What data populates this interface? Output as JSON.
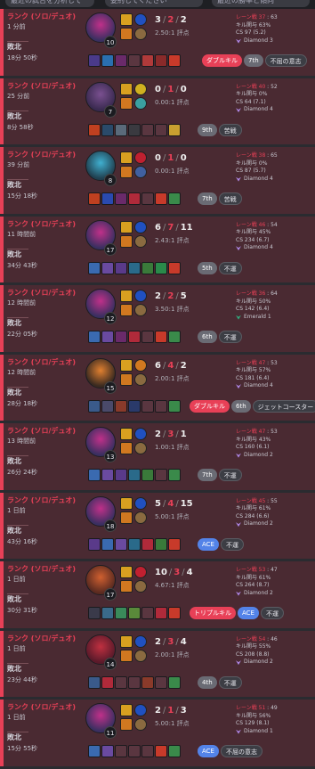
{
  "topbar": {
    "pills": [
      "最近の試合を分析して",
      "要約してください",
      "最近の勝率と傾向"
    ]
  },
  "matches": [
    {
      "queue": "ランク (ソロ/デュオ)",
      "ago": "1 分前",
      "result": "敗北",
      "duration": "18分 50秒",
      "level": "10",
      "kills": "3",
      "deaths": "2",
      "assists": "2",
      "ratio": "2.50:1 評点",
      "lane_label": "レーン戦",
      "lane_value": "37",
      "lane_extra": "63",
      "kp": "キル関与 63%",
      "cs": "CS 97 (5.2)",
      "rank": "Diamond 3",
      "rank_color": "#b088e8",
      "tags": [
        "ダブルキル",
        "7th",
        "不屈の意志"
      ],
      "tag_styles": [
        "red",
        "grey",
        "dark"
      ],
      "champ_colors": [
        "#3a2f60",
        "#c0308a"
      ],
      "item_colors": [
        "#4a3a8a",
        "#2a6fb0",
        "#6a2a6a",
        "#5a3640",
        "#b03a3a",
        "#8a2a2a",
        "#c83a2a"
      ],
      "spell_colors": [
        "#d8a020",
        "#2050c0",
        "#d07820",
        "#8a6a40"
      ]
    },
    {
      "queue": "ランク (ソロ/デュオ)",
      "ago": "25 分前",
      "result": "敗北",
      "duration": "8分 58秒",
      "level": "7",
      "kills": "0",
      "deaths": "1",
      "assists": "0",
      "ratio": "0.00:1 評点",
      "lane_label": "レーン戦",
      "lane_value": "40",
      "lane_extra": "52",
      "kp": "キル関与 0%",
      "cs": "CS 64 (7.1)",
      "rank": "Diamond 4",
      "rank_color": "#b088e8",
      "tags": [
        "9th",
        "苦戦"
      ],
      "tag_styles": [
        "grey",
        "dark"
      ],
      "champ_colors": [
        "#3a2a50",
        "#7a5090"
      ],
      "item_colors": [
        "#c04020",
        "#2a4a6a",
        "#5a6a7a",
        "#3a3a40",
        "#5a3640",
        "#5a3640",
        "#c8a030"
      ],
      "spell_colors": [
        "#d8a020",
        "#d0b020",
        "#d07820",
        "#3aa0a0"
      ]
    },
    {
      "queue": "ランク (ソロ/デュオ)",
      "ago": "39 分前",
      "result": "敗北",
      "duration": "15分 18秒",
      "level": "8",
      "kills": "0",
      "deaths": "1",
      "assists": "0",
      "ratio": "0.00:1 評点",
      "lane_label": "レーン戦",
      "lane_value": "38",
      "lane_extra": "65",
      "kp": "キル関与 0%",
      "cs": "CS 87 (5.7)",
      "rank": "Diamond 4",
      "rank_color": "#b088e8",
      "tags": [
        "7th",
        "苦戦"
      ],
      "tag_styles": [
        "grey",
        "dark"
      ],
      "champ_colors": [
        "#204050",
        "#40b0d0"
      ],
      "item_colors": [
        "#c04020",
        "#2a4ab0",
        "#6a2a6a",
        "#b02a3a",
        "#5a3640",
        "#c83a2a",
        "#3a8a4a"
      ],
      "spell_colors": [
        "#d8a020",
        "#c02030",
        "#d07820",
        "#4060a0"
      ]
    },
    {
      "queue": "ランク (ソロ/デュオ)",
      "ago": "11 時間前",
      "result": "敗北",
      "duration": "34分 43秒",
      "level": "17",
      "kills": "6",
      "deaths": "7",
      "assists": "11",
      "ratio": "2.43:1 評点",
      "lane_label": "レーン戦",
      "lane_value": "46",
      "lane_extra": "54",
      "kp": "キル関与 45%",
      "cs": "CS 234 (6.7)",
      "rank": "Diamond 4",
      "rank_color": "#b088e8",
      "tags": [
        "5th",
        "不運"
      ],
      "tag_styles": [
        "grey",
        "dark"
      ],
      "champ_colors": [
        "#3a2f60",
        "#c0308a"
      ],
      "item_colors": [
        "#3a6ab0",
        "#6a4aa0",
        "#5a3a8a",
        "#2a6a8a",
        "#3a7a3a",
        "#2a8a4a",
        "#c83a2a"
      ],
      "spell_colors": [
        "#d8a020",
        "#2050c0",
        "#d07820",
        "#8a6a40"
      ]
    },
    {
      "queue": "ランク (ソロ/デュオ)",
      "ago": "12 時間前",
      "result": "敗北",
      "duration": "22分 05秒",
      "level": "12",
      "kills": "2",
      "deaths": "2",
      "assists": "5",
      "ratio": "3.50:1 評点",
      "lane_label": "レーン戦",
      "lane_value": "36",
      "lane_extra": "64",
      "kp": "キル関与 50%",
      "cs": "CS 142 (6.4)",
      "rank": "Emerald 1",
      "rank_color": "#30b080",
      "tags": [
        "6th",
        "不運"
      ],
      "tag_styles": [
        "grey",
        "dark"
      ],
      "champ_colors": [
        "#3a2f60",
        "#c0308a"
      ],
      "item_colors": [
        "#3a6ab0",
        "#6a4aa0",
        "#6a2a6a",
        "#b02a3a",
        "#5a3640",
        "#c83a2a",
        "#3a8a4a"
      ],
      "spell_colors": [
        "#d8a020",
        "#2050c0",
        "#d07820",
        "#8a6a40"
      ]
    },
    {
      "queue": "ランク (ソロ/デュオ)",
      "ago": "12 時間前",
      "result": "敗北",
      "duration": "28分 18秒",
      "level": "15",
      "kills": "6",
      "deaths": "4",
      "assists": "2",
      "ratio": "2.00:1 評点",
      "lane_label": "レーン戦",
      "lane_value": "47",
      "lane_extra": "53",
      "kp": "キル関与 57%",
      "cs": "CS 181 (6.4)",
      "rank": "Diamond 4",
      "rank_color": "#b088e8",
      "tags": [
        "ダブルキル",
        "6th",
        "ジェットコースター"
      ],
      "tag_styles": [
        "red",
        "grey",
        "dark"
      ],
      "champ_colors": [
        "#3a2a20",
        "#e08030"
      ],
      "item_colors": [
        "#3a5a8a",
        "#4a4a6a",
        "#8a3a2a",
        "#2a3a6a",
        "#5a3640",
        "#5a3640",
        "#3a8a4a"
      ],
      "spell_colors": [
        "#d8a020",
        "#d07820",
        "#d07820",
        "#8a6a40"
      ]
    },
    {
      "queue": "ランク (ソロ/デュオ)",
      "ago": "13 時間前",
      "result": "敗北",
      "duration": "26分 24秒",
      "level": "13",
      "kills": "2",
      "deaths": "3",
      "assists": "1",
      "ratio": "1.00:1 評点",
      "lane_label": "レーン戦",
      "lane_value": "47",
      "lane_extra": "53",
      "kp": "キル関与 43%",
      "cs": "CS 160 (6.1)",
      "rank": "Diamond 2",
      "rank_color": "#b088e8",
      "tags": [
        "7th",
        "不運"
      ],
      "tag_styles": [
        "grey",
        "dark"
      ],
      "champ_colors": [
        "#3a2f60",
        "#c0308a"
      ],
      "item_colors": [
        "#3a6ab0",
        "#6a4aa0",
        "#5a3a8a",
        "#2a6a8a",
        "#3a7a3a",
        "#5a3640",
        "#3a8a4a"
      ],
      "spell_colors": [
        "#d8a020",
        "#2050c0",
        "#d07820",
        "#8a6a40"
      ]
    },
    {
      "queue": "ランク (ソロ/デュオ)",
      "ago": "1 日前",
      "result": "敗北",
      "duration": "43分 16秒",
      "level": "18",
      "kills": "5",
      "deaths": "4",
      "assists": "15",
      "ratio": "5.00:1 評点",
      "lane_label": "レーン戦",
      "lane_value": "45",
      "lane_extra": "55",
      "kp": "キル関与 61%",
      "cs": "CS 284 (6.6)",
      "rank": "Diamond 2",
      "rank_color": "#b088e8",
      "tags": [
        "ACE",
        "不運"
      ],
      "tag_styles": [
        "blue",
        "dark"
      ],
      "champ_colors": [
        "#3a2f60",
        "#c0308a"
      ],
      "item_colors": [
        "#5a3a8a",
        "#3a6ab0",
        "#6a4aa0",
        "#2a6a8a",
        "#b02a3a",
        "#3a7a3a",
        "#c83a2a"
      ],
      "spell_colors": [
        "#d8a020",
        "#2050c0",
        "#d07820",
        "#8a6a40"
      ]
    },
    {
      "queue": "ランク (ソロ/デュオ)",
      "ago": "1 日前",
      "result": "敗北",
      "duration": "30分 31秒",
      "level": "17",
      "kills": "10",
      "deaths": "3",
      "assists": "4",
      "ratio": "4.67:1 評点",
      "lane_label": "レーン戦",
      "lane_value": "53",
      "lane_extra": "47",
      "kp": "キル関与 61%",
      "cs": "CS 264 (8.7)",
      "rank": "Diamond 2",
      "rank_color": "#b088e8",
      "tags": [
        "トリプルキル",
        "ACE",
        "不運"
      ],
      "tag_styles": [
        "red",
        "blue",
        "dark"
      ],
      "champ_colors": [
        "#5a2a20",
        "#d06030"
      ],
      "item_colors": [
        "#3a3a4a",
        "#3a6a8a",
        "#3a8a5a",
        "#5a8a3a",
        "#5a3640",
        "#b02a3a",
        "#c83a2a"
      ],
      "spell_colors": [
        "#d8a020",
        "#c02030",
        "#d07820",
        "#8a6a40"
      ]
    },
    {
      "queue": "ランク (ソロ/デュオ)",
      "ago": "1 日前",
      "result": "敗北",
      "duration": "23分 44秒",
      "level": "14",
      "kills": "2",
      "deaths": "3",
      "assists": "4",
      "ratio": "2.00:1 評点",
      "lane_label": "レーン戦",
      "lane_value": "54",
      "lane_extra": "46",
      "kp": "キル関与 55%",
      "cs": "CS 208 (8.8)",
      "rank": "Diamond 2",
      "rank_color": "#b088e8",
      "tags": [
        "4th",
        "不運"
      ],
      "tag_styles": [
        "grey",
        "dark"
      ],
      "champ_colors": [
        "#5a1a2a",
        "#c03040"
      ],
      "item_colors": [
        "#3a5a8a",
        "#b02a3a",
        "#5a3640",
        "#5a3640",
        "#8a3a2a",
        "#5a3640",
        "#3a8a4a"
      ],
      "spell_colors": [
        "#d8a020",
        "#2050c0",
        "#d07820",
        "#8a6a40"
      ]
    },
    {
      "queue": "ランク (ソロ/デュオ)",
      "ago": "1 日前",
      "result": "敗北",
      "duration": "15分 55秒",
      "level": "11",
      "kills": "2",
      "deaths": "1",
      "assists": "3",
      "ratio": "5.00:1 評点",
      "lane_label": "レーン戦",
      "lane_value": "51",
      "lane_extra": "49",
      "kp": "キル関与 56%",
      "cs": "CS 129 (8.1)",
      "rank": "Diamond 1",
      "rank_color": "#b088e8",
      "tags": [
        "ACE",
        "不屈の意志"
      ],
      "tag_styles": [
        "blue",
        "dark"
      ],
      "champ_colors": [
        "#3a2f60",
        "#c0308a"
      ],
      "item_colors": [
        "#3a6ab0",
        "#6a4aa0",
        "#5a3640",
        "#5a3640",
        "#5a3640",
        "#c83a2a",
        "#3a8a4a"
      ],
      "spell_colors": [
        "#d8a020",
        "#2050c0",
        "#d07820",
        "#8a6a40"
      ]
    }
  ]
}
